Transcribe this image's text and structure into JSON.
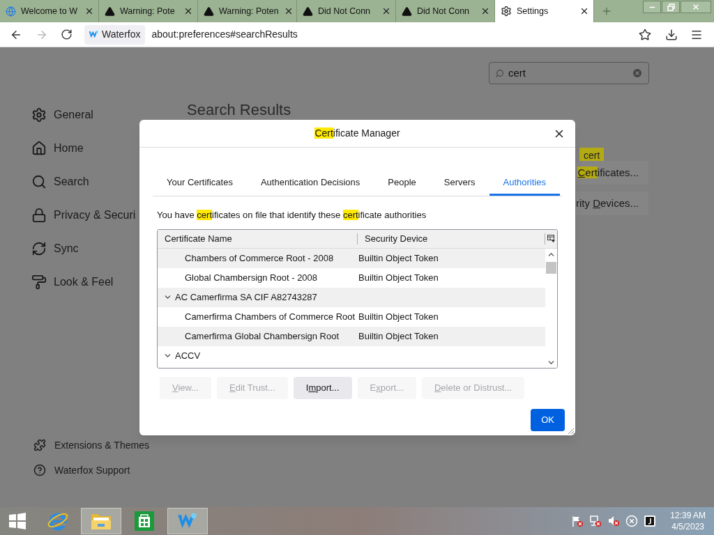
{
  "browser": {
    "tabs": [
      {
        "kind": "welcome",
        "title": "Welcome to W",
        "selected": false
      },
      {
        "kind": "warning",
        "title": "Warning: Pote",
        "selected": false
      },
      {
        "kind": "warning",
        "title": "Warning: Poten",
        "selected": false
      },
      {
        "kind": "warning",
        "title": "Did Not Conn",
        "selected": false
      },
      {
        "kind": "warning",
        "title": "Did Not Conn",
        "selected": false
      },
      {
        "kind": "settings",
        "title": "Settings",
        "selected": true
      }
    ],
    "identity": "Waterfox",
    "url": "about:preferences#searchResults"
  },
  "sidebar": {
    "items": [
      {
        "kind": "general",
        "label": "General"
      },
      {
        "kind": "home",
        "label": "Home"
      },
      {
        "kind": "search",
        "label": "Search"
      },
      {
        "kind": "privacy",
        "label": "Privacy & Securi"
      },
      {
        "kind": "sync",
        "label": "Sync"
      },
      {
        "kind": "look",
        "label": "Look & Feel"
      }
    ],
    "footer": [
      {
        "kind": "extensions",
        "label": "Extensions & Themes"
      },
      {
        "kind": "support",
        "label": "Waterfox Support"
      }
    ]
  },
  "search": {
    "value": "cert"
  },
  "results": {
    "heading": "Search Results",
    "tooltip": "cert",
    "buttons": [
      {
        "parts": [
          {
            "text": "C",
            "highlight": true,
            "underline": true
          },
          {
            "text": "ert",
            "highlight": true,
            "underline": false
          },
          {
            "text": "ificates...",
            "highlight": false,
            "underline": false
          }
        ]
      },
      {
        "parts": [
          {
            "text": "rity ",
            "highlight": false,
            "underline": false
          },
          {
            "text": "D",
            "highlight": false,
            "underline": true
          },
          {
            "text": "evices...",
            "highlight": false,
            "underline": false
          }
        ]
      }
    ]
  },
  "dialog": {
    "title": [
      {
        "text": "Cert",
        "highlight": true
      },
      {
        "text": "ificate Manager",
        "highlight": false
      }
    ],
    "tabs": [
      {
        "label": "Your Certificates",
        "selected": false
      },
      {
        "label": "Authentication Decisions",
        "selected": false
      },
      {
        "label": "People",
        "selected": false
      },
      {
        "label": "Servers",
        "selected": false
      },
      {
        "label": "Authorities",
        "selected": true
      }
    ],
    "description": [
      {
        "text": "You have ",
        "highlight": false
      },
      {
        "text": "cert",
        "highlight": true
      },
      {
        "text": "ificates on file that identify these ",
        "highlight": false
      },
      {
        "text": "cert",
        "highlight": true
      },
      {
        "text": "ificate authorities",
        "highlight": false
      }
    ],
    "tree": {
      "columns": [
        "Certificate Name",
        "Security Device"
      ],
      "rows": [
        {
          "kind": "continuation",
          "children": [
            {
              "kind": "cert",
              "name": "Chambers of Commerce Root - 2008",
              "device": "Builtin Object Token"
            },
            {
              "kind": "cert",
              "name": "Global Chambersign Root - 2008",
              "device": "Builtin Object Token"
            }
          ]
        },
        {
          "kind": "group",
          "name": "AC Camerfirma SA CIF A82743287",
          "expanded": true,
          "children": [
            {
              "kind": "cert",
              "name": "Camerfirma Chambers of Commerce Root",
              "device": "Builtin Object Token"
            },
            {
              "kind": "cert",
              "name": "Camerfirma Global Chambersign Root",
              "device": "Builtin Object Token"
            }
          ]
        },
        {
          "kind": "group",
          "name": "ACCV",
          "expanded": true
        }
      ]
    },
    "buttons": [
      {
        "disabled": true,
        "parts": [
          {
            "text": "V",
            "underline": true
          },
          {
            "text": "iew...",
            "underline": false
          }
        ]
      },
      {
        "disabled": true,
        "parts": [
          {
            "text": "E",
            "underline": true
          },
          {
            "text": "dit Trust...",
            "underline": false
          }
        ]
      },
      {
        "disabled": false,
        "parts": [
          {
            "text": "I",
            "underline": false
          },
          {
            "text": "m",
            "underline": true
          },
          {
            "text": "port...",
            "underline": false
          }
        ]
      },
      {
        "disabled": true,
        "parts": [
          {
            "text": "E",
            "underline": false
          },
          {
            "text": "x",
            "underline": true
          },
          {
            "text": "port...",
            "underline": false
          }
        ]
      },
      {
        "disabled": true,
        "parts": [
          {
            "text": "D",
            "underline": true
          },
          {
            "text": "elete or Distrust...",
            "underline": false
          }
        ]
      }
    ],
    "ok": "OK"
  },
  "taskbar": {
    "apps": [
      {
        "kind": "start",
        "active": false
      },
      {
        "kind": "ie",
        "active": false
      },
      {
        "kind": "explorer",
        "active": true
      },
      {
        "kind": "store",
        "active": false
      },
      {
        "kind": "waterfox",
        "active": true
      }
    ],
    "tray": [
      {
        "kind": "flag"
      },
      {
        "kind": "network"
      },
      {
        "kind": "volume"
      },
      {
        "kind": "error"
      },
      {
        "kind": "app"
      }
    ],
    "time": "12:39 AM",
    "date": "4/5/2023"
  }
}
